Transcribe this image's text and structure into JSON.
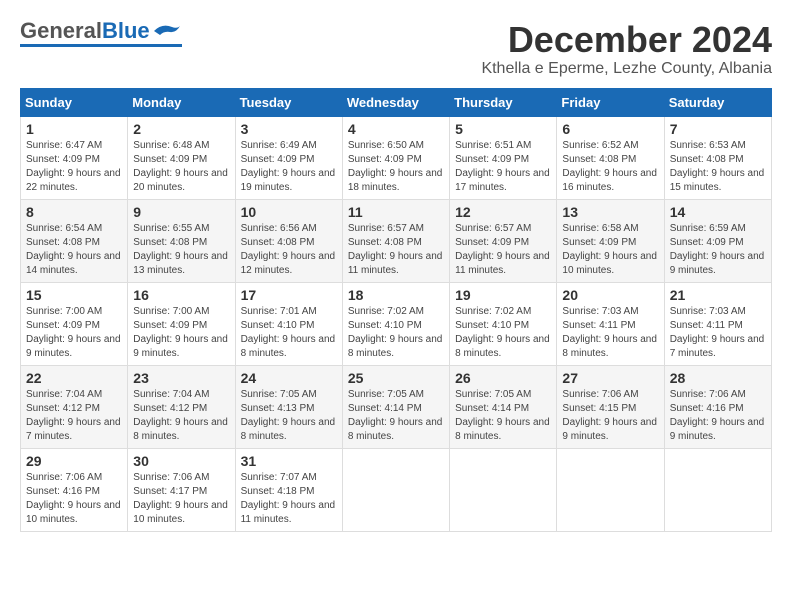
{
  "logo": {
    "general": "General",
    "blue": "Blue"
  },
  "title": "December 2024",
  "location": "Kthella e Eperme, Lezhe County, Albania",
  "days_of_week": [
    "Sunday",
    "Monday",
    "Tuesday",
    "Wednesday",
    "Thursday",
    "Friday",
    "Saturday"
  ],
  "weeks": [
    [
      {
        "day": "1",
        "sunrise": "6:47 AM",
        "sunset": "4:09 PM",
        "daylight": "9 hours and 22 minutes."
      },
      {
        "day": "2",
        "sunrise": "6:48 AM",
        "sunset": "4:09 PM",
        "daylight": "9 hours and 20 minutes."
      },
      {
        "day": "3",
        "sunrise": "6:49 AM",
        "sunset": "4:09 PM",
        "daylight": "9 hours and 19 minutes."
      },
      {
        "day": "4",
        "sunrise": "6:50 AM",
        "sunset": "4:09 PM",
        "daylight": "9 hours and 18 minutes."
      },
      {
        "day": "5",
        "sunrise": "6:51 AM",
        "sunset": "4:09 PM",
        "daylight": "9 hours and 17 minutes."
      },
      {
        "day": "6",
        "sunrise": "6:52 AM",
        "sunset": "4:08 PM",
        "daylight": "9 hours and 16 minutes."
      },
      {
        "day": "7",
        "sunrise": "6:53 AM",
        "sunset": "4:08 PM",
        "daylight": "9 hours and 15 minutes."
      }
    ],
    [
      {
        "day": "8",
        "sunrise": "6:54 AM",
        "sunset": "4:08 PM",
        "daylight": "9 hours and 14 minutes."
      },
      {
        "day": "9",
        "sunrise": "6:55 AM",
        "sunset": "4:08 PM",
        "daylight": "9 hours and 13 minutes."
      },
      {
        "day": "10",
        "sunrise": "6:56 AM",
        "sunset": "4:08 PM",
        "daylight": "9 hours and 12 minutes."
      },
      {
        "day": "11",
        "sunrise": "6:57 AM",
        "sunset": "4:08 PM",
        "daylight": "9 hours and 11 minutes."
      },
      {
        "day": "12",
        "sunrise": "6:57 AM",
        "sunset": "4:09 PM",
        "daylight": "9 hours and 11 minutes."
      },
      {
        "day": "13",
        "sunrise": "6:58 AM",
        "sunset": "4:09 PM",
        "daylight": "9 hours and 10 minutes."
      },
      {
        "day": "14",
        "sunrise": "6:59 AM",
        "sunset": "4:09 PM",
        "daylight": "9 hours and 9 minutes."
      }
    ],
    [
      {
        "day": "15",
        "sunrise": "7:00 AM",
        "sunset": "4:09 PM",
        "daylight": "9 hours and 9 minutes."
      },
      {
        "day": "16",
        "sunrise": "7:00 AM",
        "sunset": "4:09 PM",
        "daylight": "9 hours and 9 minutes."
      },
      {
        "day": "17",
        "sunrise": "7:01 AM",
        "sunset": "4:10 PM",
        "daylight": "9 hours and 8 minutes."
      },
      {
        "day": "18",
        "sunrise": "7:02 AM",
        "sunset": "4:10 PM",
        "daylight": "9 hours and 8 minutes."
      },
      {
        "day": "19",
        "sunrise": "7:02 AM",
        "sunset": "4:10 PM",
        "daylight": "9 hours and 8 minutes."
      },
      {
        "day": "20",
        "sunrise": "7:03 AM",
        "sunset": "4:11 PM",
        "daylight": "9 hours and 8 minutes."
      },
      {
        "day": "21",
        "sunrise": "7:03 AM",
        "sunset": "4:11 PM",
        "daylight": "9 hours and 7 minutes."
      }
    ],
    [
      {
        "day": "22",
        "sunrise": "7:04 AM",
        "sunset": "4:12 PM",
        "daylight": "9 hours and 7 minutes."
      },
      {
        "day": "23",
        "sunrise": "7:04 AM",
        "sunset": "4:12 PM",
        "daylight": "9 hours and 8 minutes."
      },
      {
        "day": "24",
        "sunrise": "7:05 AM",
        "sunset": "4:13 PM",
        "daylight": "9 hours and 8 minutes."
      },
      {
        "day": "25",
        "sunrise": "7:05 AM",
        "sunset": "4:14 PM",
        "daylight": "9 hours and 8 minutes."
      },
      {
        "day": "26",
        "sunrise": "7:05 AM",
        "sunset": "4:14 PM",
        "daylight": "9 hours and 8 minutes."
      },
      {
        "day": "27",
        "sunrise": "7:06 AM",
        "sunset": "4:15 PM",
        "daylight": "9 hours and 9 minutes."
      },
      {
        "day": "28",
        "sunrise": "7:06 AM",
        "sunset": "4:16 PM",
        "daylight": "9 hours and 9 minutes."
      }
    ],
    [
      {
        "day": "29",
        "sunrise": "7:06 AM",
        "sunset": "4:16 PM",
        "daylight": "9 hours and 10 minutes."
      },
      {
        "day": "30",
        "sunrise": "7:06 AM",
        "sunset": "4:17 PM",
        "daylight": "9 hours and 10 minutes."
      },
      {
        "day": "31",
        "sunrise": "7:07 AM",
        "sunset": "4:18 PM",
        "daylight": "9 hours and 11 minutes."
      },
      null,
      null,
      null,
      null
    ]
  ]
}
